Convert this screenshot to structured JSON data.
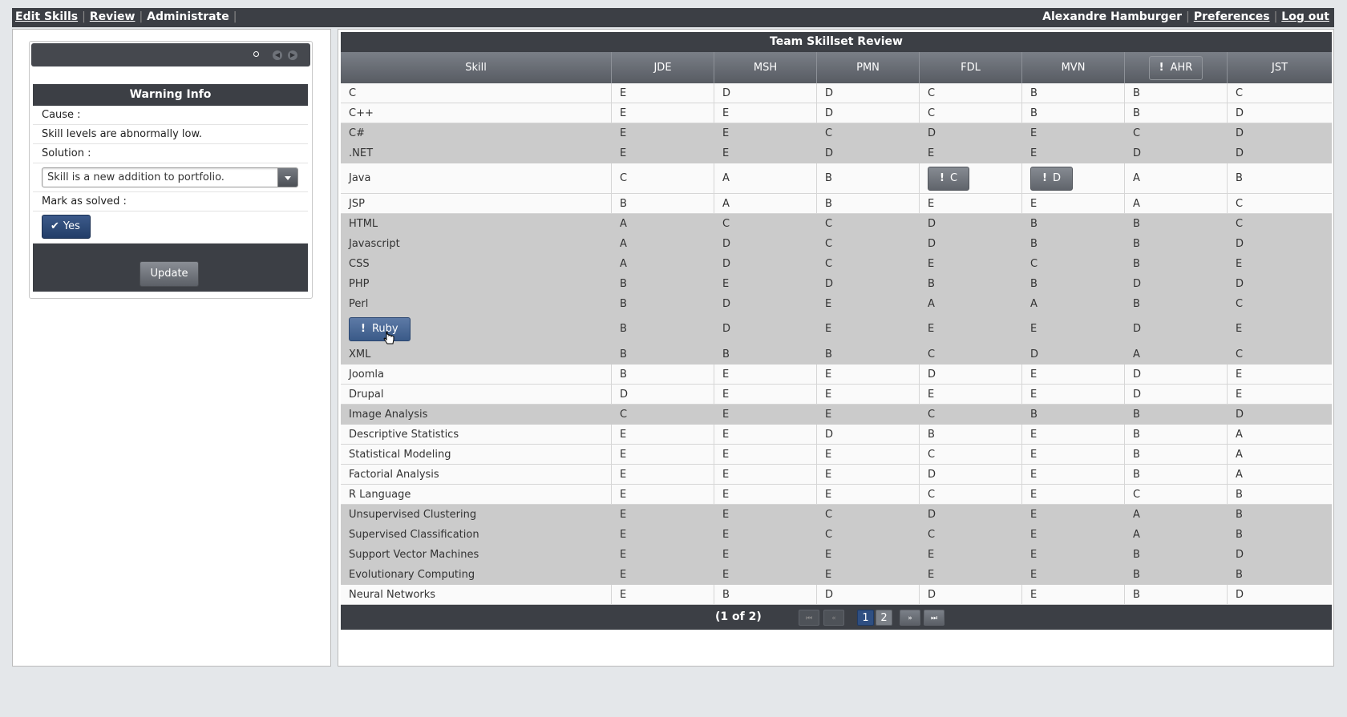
{
  "nav": {
    "edit_skills": "Edit Skills",
    "review": "Review",
    "administrate": "Administrate",
    "separator": "|",
    "user_name": "Alexandre Hamburger",
    "preferences": "Preferences",
    "logout": "Log out"
  },
  "warning": {
    "title": "Warning Info",
    "cause_label": "Cause :",
    "cause_text": "Skill levels are abnormally low.",
    "solution_label": "Solution :",
    "solution_value": "Skill is a new addition to portfolio.",
    "mark_label": "Mark as solved :",
    "yes_label": "Yes",
    "update_label": "Update"
  },
  "table": {
    "title": "Team Skillset Review",
    "columns": [
      "Skill",
      "JDE",
      "MSH",
      "PMN",
      "FDL",
      "MVN",
      "AHR",
      "JST"
    ],
    "flagged_column": "AHR",
    "rows": [
      {
        "skill": "C",
        "v": [
          "E",
          "D",
          "D",
          "C",
          "B",
          "B",
          "C"
        ],
        "shade": "w"
      },
      {
        "skill": "C++",
        "v": [
          "E",
          "E",
          "D",
          "C",
          "B",
          "B",
          "D"
        ],
        "shade": "w"
      },
      {
        "skill": "C#",
        "v": [
          "E",
          "E",
          "C",
          "D",
          "E",
          "C",
          "D"
        ],
        "shade": "g"
      },
      {
        "skill": ".NET",
        "v": [
          "E",
          "E",
          "D",
          "E",
          "E",
          "D",
          "D"
        ],
        "shade": "g"
      },
      {
        "skill": "Java",
        "v": [
          "C",
          "A",
          "B",
          "C",
          "D",
          "A",
          "B"
        ],
        "shade": "w",
        "tall": true,
        "flags": [
          3,
          4
        ]
      },
      {
        "skill": "JSP",
        "v": [
          "B",
          "A",
          "B",
          "E",
          "E",
          "A",
          "C"
        ],
        "shade": "w"
      },
      {
        "skill": "HTML",
        "v": [
          "A",
          "C",
          "C",
          "D",
          "B",
          "B",
          "C"
        ],
        "shade": "g"
      },
      {
        "skill": "Javascript",
        "v": [
          "A",
          "D",
          "C",
          "D",
          "B",
          "B",
          "D"
        ],
        "shade": "g"
      },
      {
        "skill": "CSS",
        "v": [
          "A",
          "D",
          "C",
          "E",
          "C",
          "B",
          "E"
        ],
        "shade": "g"
      },
      {
        "skill": "PHP",
        "v": [
          "B",
          "E",
          "D",
          "B",
          "B",
          "D",
          "D"
        ],
        "shade": "g"
      },
      {
        "skill": "Perl",
        "v": [
          "B",
          "D",
          "E",
          "A",
          "A",
          "B",
          "C"
        ],
        "shade": "g"
      },
      {
        "skill": "Ruby",
        "v": [
          "B",
          "D",
          "E",
          "E",
          "E",
          "D",
          "E"
        ],
        "shade": "g",
        "tall": true,
        "skill_flag": true
      },
      {
        "skill": "XML",
        "v": [
          "B",
          "B",
          "B",
          "C",
          "D",
          "A",
          "C"
        ],
        "shade": "g"
      },
      {
        "skill": "Joomla",
        "v": [
          "B",
          "E",
          "E",
          "D",
          "E",
          "D",
          "E"
        ],
        "shade": "w"
      },
      {
        "skill": "Drupal",
        "v": [
          "D",
          "E",
          "E",
          "E",
          "E",
          "D",
          "E"
        ],
        "shade": "w"
      },
      {
        "skill": "Image Analysis",
        "v": [
          "C",
          "E",
          "E",
          "C",
          "B",
          "B",
          "D"
        ],
        "shade": "g"
      },
      {
        "skill": "Descriptive Statistics",
        "v": [
          "E",
          "E",
          "D",
          "B",
          "E",
          "B",
          "A"
        ],
        "shade": "w"
      },
      {
        "skill": "Statistical Modeling",
        "v": [
          "E",
          "E",
          "E",
          "C",
          "E",
          "B",
          "A"
        ],
        "shade": "w"
      },
      {
        "skill": "Factorial Analysis",
        "v": [
          "E",
          "E",
          "E",
          "D",
          "E",
          "B",
          "A"
        ],
        "shade": "w"
      },
      {
        "skill": "R Language",
        "v": [
          "E",
          "E",
          "E",
          "C",
          "E",
          "C",
          "B"
        ],
        "shade": "w"
      },
      {
        "skill": "Unsupervised Clustering",
        "v": [
          "E",
          "E",
          "C",
          "D",
          "E",
          "A",
          "B"
        ],
        "shade": "g"
      },
      {
        "skill": "Supervised Classification",
        "v": [
          "E",
          "E",
          "C",
          "C",
          "E",
          "A",
          "B"
        ],
        "shade": "g"
      },
      {
        "skill": "Support Vector Machines",
        "v": [
          "E",
          "E",
          "E",
          "E",
          "E",
          "B",
          "D"
        ],
        "shade": "g"
      },
      {
        "skill": "Evolutionary Computing",
        "v": [
          "E",
          "E",
          "E",
          "E",
          "E",
          "B",
          "B"
        ],
        "shade": "g"
      },
      {
        "skill": "Neural Networks",
        "v": [
          "E",
          "B",
          "D",
          "D",
          "E",
          "B",
          "D"
        ],
        "shade": "w"
      }
    ]
  },
  "pager": {
    "info": "(1 of 2)",
    "first": "⏮",
    "prev": "«",
    "pages": [
      "1",
      "2"
    ],
    "next": "»",
    "last": "⏭"
  },
  "icons": {
    "check": "✔",
    "flag": "!",
    "cursor": "hand-pointer-icon"
  },
  "colors": {
    "dark_bar": "#3c3f45",
    "shaded_row": "#cbcbcb",
    "accent_blue": "#2f4f82"
  }
}
